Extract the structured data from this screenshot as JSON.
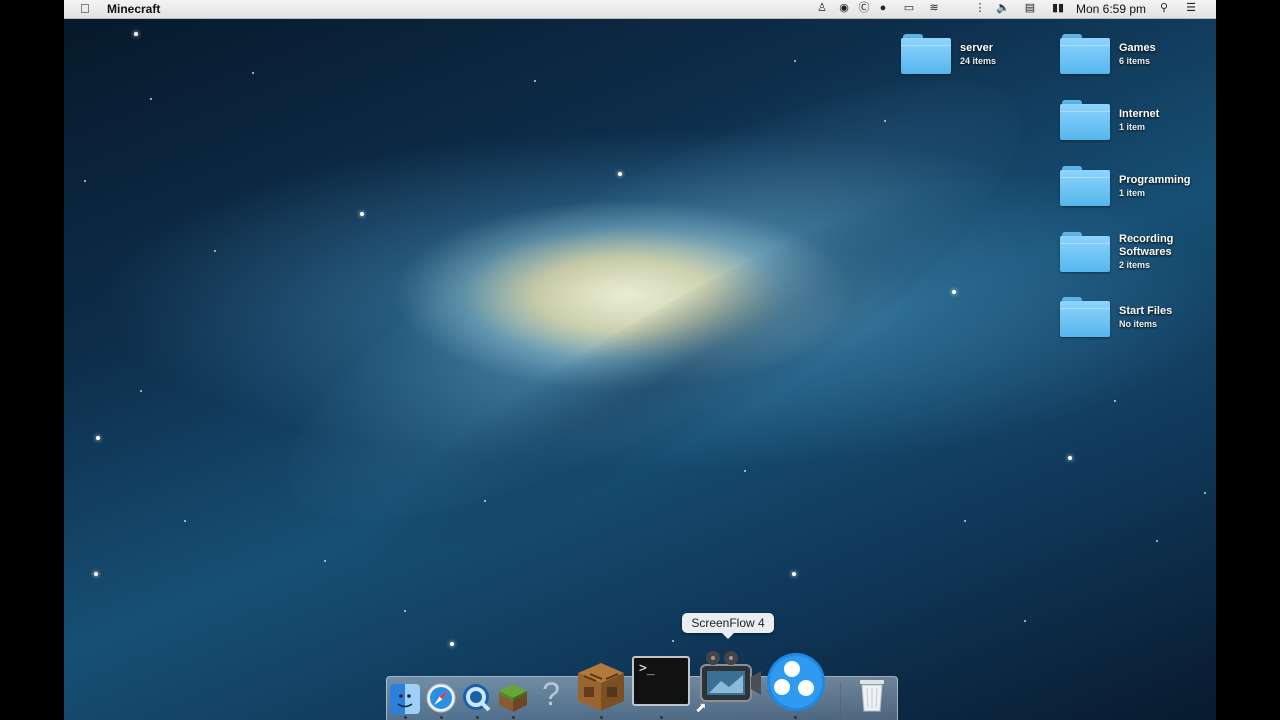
{
  "menubar": {
    "apple_icon": "apple-logo-icon",
    "app_name": "Minecraft",
    "clock": "Mon 6:59 pm",
    "status_icons": [
      "theatre-icon",
      "record-icon",
      "skype-icon",
      "app-icon",
      "airplay-icon",
      "wifi-icon",
      "sound-level-icon",
      "volume-icon",
      "calendar-icon",
      "battery-icon",
      "spotlight-icon",
      "notification-center-icon"
    ]
  },
  "desktop": {
    "items": [
      {
        "name": "server",
        "sub": "24 items"
      },
      {
        "name": "Games",
        "sub": "6 items"
      },
      {
        "name": "Internet",
        "sub": "1 item"
      },
      {
        "name": "Programming",
        "sub": "1 item"
      },
      {
        "name": "Recording Softwares",
        "sub": "2 items"
      },
      {
        "name": "Start Files",
        "sub": "No items"
      }
    ]
  },
  "dock": {
    "tooltip": "ScreenFlow 4",
    "items": [
      "finder",
      "safari",
      "quicktime",
      "minecraft",
      "help",
      "crafting-table",
      "terminal",
      "screenflow",
      "teamviewer",
      "trash"
    ]
  }
}
